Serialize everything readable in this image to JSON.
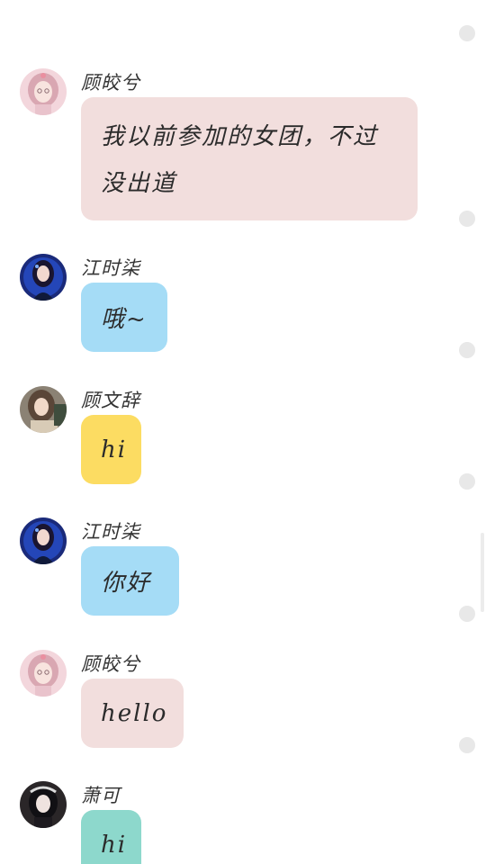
{
  "messages": [
    {
      "sender": "顾皎兮",
      "text": "我以前参加的女团，不过没出道",
      "color": "#f2dedd",
      "avatar": "pink-hair-girl-avatar"
    },
    {
      "sender": "江时柒",
      "text": "哦~",
      "color": "#a5dcf6",
      "avatar": "blue-dress-girl-avatar"
    },
    {
      "sender": "顾文辞",
      "text": "hi",
      "color": "#fcdc62",
      "avatar": "brown-hair-girl-avatar"
    },
    {
      "sender": "江时柒",
      "text": "你好",
      "color": "#a5dcf6",
      "avatar": "blue-dress-girl-avatar"
    },
    {
      "sender": "顾皎兮",
      "text": "hello",
      "color": "#f2dedd",
      "avatar": "pink-hair-girl-avatar"
    },
    {
      "sender": "萧可",
      "text": "hi",
      "color": "#8dd8cc",
      "avatar": "black-hair-girl-avatar"
    }
  ]
}
